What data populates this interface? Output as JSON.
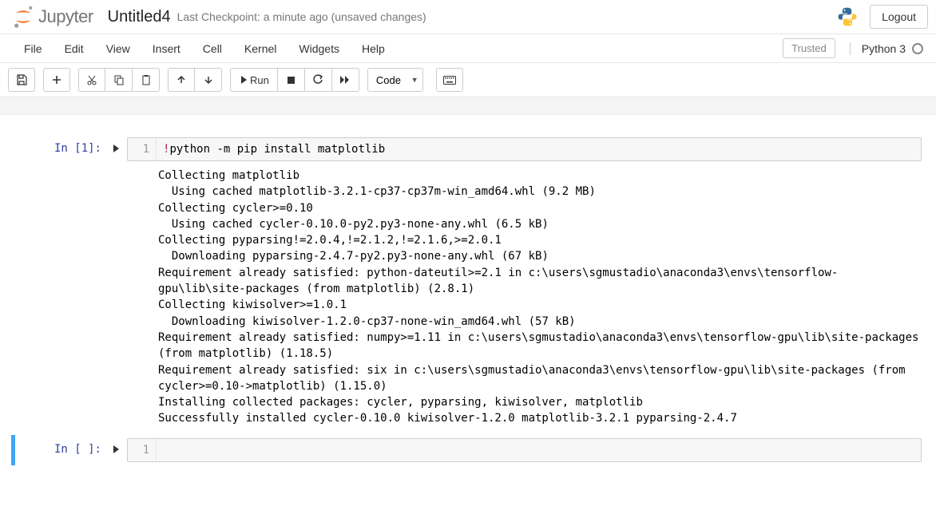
{
  "header": {
    "logo_text": "Jupyter",
    "notebook_name": "Untitled4",
    "checkpoint": "Last Checkpoint: a minute ago   (unsaved changes)",
    "logout": "Logout"
  },
  "menubar": {
    "items": [
      "File",
      "Edit",
      "View",
      "Insert",
      "Cell",
      "Kernel",
      "Widgets",
      "Help"
    ],
    "trusted": "Trusted",
    "kernel": "Python 3"
  },
  "toolbar": {
    "run_label": "Run",
    "cell_type": "Code"
  },
  "cells": [
    {
      "prompt": "In [1]:",
      "line_no": "1",
      "code_prefix": "!",
      "code_rest": "python -m pip install matplotlib",
      "output": "Collecting matplotlib\n  Using cached matplotlib-3.2.1-cp37-cp37m-win_amd64.whl (9.2 MB)\nCollecting cycler>=0.10\n  Using cached cycler-0.10.0-py2.py3-none-any.whl (6.5 kB)\nCollecting pyparsing!=2.0.4,!=2.1.2,!=2.1.6,>=2.0.1\n  Downloading pyparsing-2.4.7-py2.py3-none-any.whl (67 kB)\nRequirement already satisfied: python-dateutil>=2.1 in c:\\users\\sgmustadio\\anaconda3\\envs\\tensorflow-gpu\\lib\\site-packages (from matplotlib) (2.8.1)\nCollecting kiwisolver>=1.0.1\n  Downloading kiwisolver-1.2.0-cp37-none-win_amd64.whl (57 kB)\nRequirement already satisfied: numpy>=1.11 in c:\\users\\sgmustadio\\anaconda3\\envs\\tensorflow-gpu\\lib\\site-packages (from matplotlib) (1.18.5)\nRequirement already satisfied: six in c:\\users\\sgmustadio\\anaconda3\\envs\\tensorflow-gpu\\lib\\site-packages (from cycler>=0.10->matplotlib) (1.15.0)\nInstalling collected packages: cycler, pyparsing, kiwisolver, matplotlib\nSuccessfully installed cycler-0.10.0 kiwisolver-1.2.0 matplotlib-3.2.1 pyparsing-2.4.7"
    },
    {
      "prompt": "In [ ]:",
      "line_no": "1",
      "code_prefix": "",
      "code_rest": ""
    }
  ]
}
